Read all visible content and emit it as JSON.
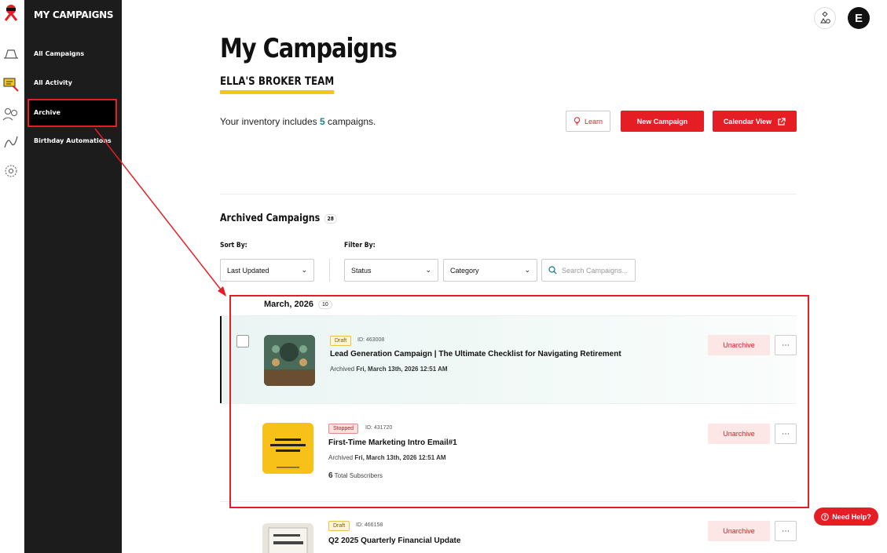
{
  "sidebar": {
    "title": "MY CAMPAIGNS",
    "items": [
      {
        "label": "All Campaigns"
      },
      {
        "label": "All Activity"
      },
      {
        "label": "Archive"
      },
      {
        "label": "Birthday Automations"
      }
    ]
  },
  "header": {
    "avatar_initial": "E",
    "page_title": "My Campaigns",
    "team_name": "ELLA'S BROKER TEAM",
    "inventory_prefix": "Your inventory includes",
    "inventory_count": "5",
    "inventory_suffix": "campaigns."
  },
  "actions": {
    "learn_label": "Learn",
    "new_campaign_label": "New Campaign",
    "calendar_view_label": "Calendar View"
  },
  "archived": {
    "section_title": "Archived Campaigns",
    "count": "28",
    "sort_label": "Sort By:",
    "filter_label": "Filter By:",
    "sort_value": "Last Updated",
    "status_value": "Status",
    "category_value": "Category",
    "search_placeholder": "Search Campaigns...",
    "month_label": "March, 2026",
    "month_count": "10"
  },
  "campaigns": [
    {
      "badge": "Draft",
      "id_text": "ID: 463008",
      "title": "Lead Generation Campaign | The Ultimate Checklist for Navigating Retirement",
      "archived_prefix": "Archived",
      "archived_date": "Fri, March 13th, 2026 12:51 AM",
      "unarchive_label": "Unarchive",
      "thumb_text": "THE ULTIMATE CHECKLIST FOR NAVIGATING RETIREMENT"
    },
    {
      "badge": "Stopped",
      "id_text": "ID: 431720",
      "title": "First-Time Marketing Intro Email#1",
      "archived_prefix": "Archived",
      "archived_date": "Fri, March 13th, 2026 12:51 AM",
      "subscribers_count": "6",
      "subscribers_label": "Total Subscribers",
      "unarchive_label": "Unarchive",
      "thumb_text": "EMAIL 1: FIRST-TIME MARKETING INTRO EMAIL"
    },
    {
      "badge": "Draft",
      "id_text": "ID: 466158",
      "title": "Q2 2025 Quarterly Financial Update",
      "unarchive_label": "Unarchive",
      "thumb_text": "Q2 2025 Markets"
    }
  ],
  "help": {
    "label": "Need Help?"
  },
  "colors": {
    "accent": "#e51e25",
    "highlight": "#f5c518",
    "teal": "#1a7f8e"
  }
}
